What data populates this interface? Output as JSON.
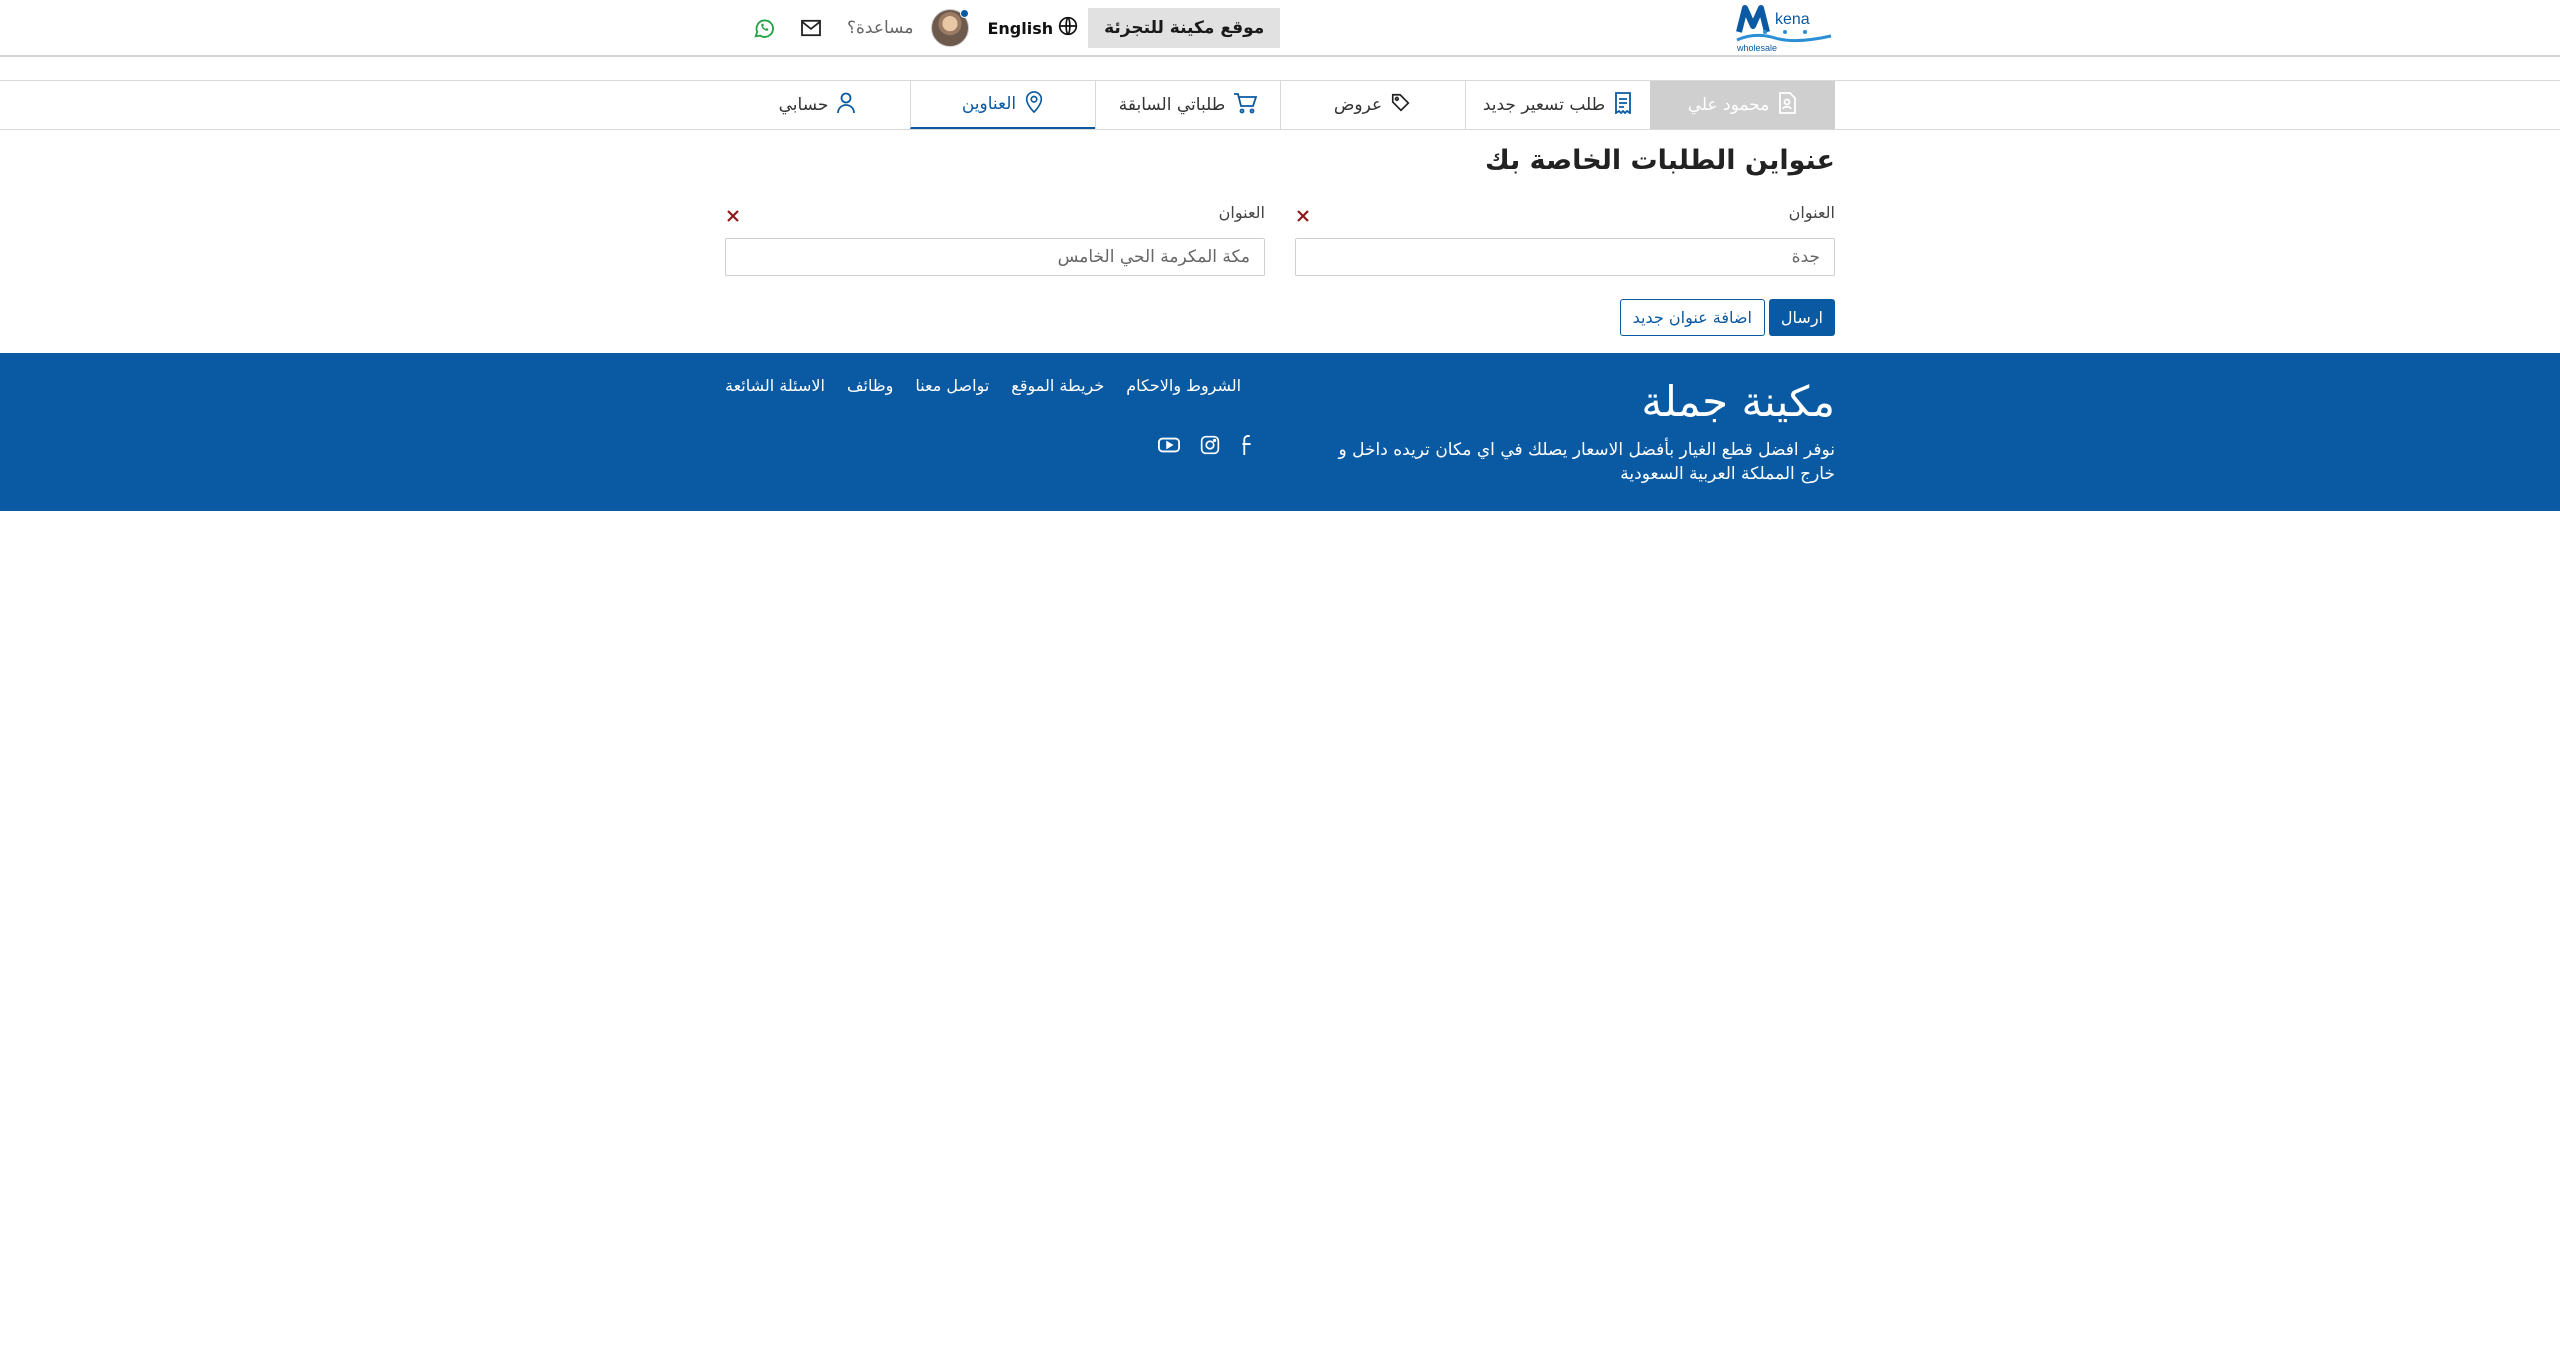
{
  "header": {
    "logo_text": "kena",
    "logo_sub": "wholesale",
    "retail_site": "موقع مكينة للتجزئة",
    "language": "English",
    "help": "مساعدة؟"
  },
  "tabs": [
    {
      "label": "محمود علي",
      "icon": "document-user-icon"
    },
    {
      "label": "طلب تسعير جديد",
      "icon": "receipt-icon"
    },
    {
      "label": "عروض",
      "icon": "tag-icon"
    },
    {
      "label": "طلباتي السابقة",
      "icon": "cart-icon"
    },
    {
      "label": "العناوين",
      "icon": "location-pin-icon"
    },
    {
      "label": "حسابي",
      "icon": "user-icon"
    }
  ],
  "main": {
    "title": "عنواين الطلبات الخاصة بك",
    "addresses": [
      {
        "label": "العنوان",
        "value": "جدة"
      },
      {
        "label": "العنوان",
        "value": "مكة المكرمة الحي الخامس"
      }
    ],
    "submit": "ارسال",
    "add_address": "اضافة عنوان جديد"
  },
  "footer": {
    "brand": "مكينة جملة",
    "description": "نوفر افضل قطع الغيار بأفضل الاسعار يصلك في اي مكان تريده داخل و خارج المملكة العربية السعودية",
    "links": [
      "الاسئلة الشائعة",
      "وظائف",
      "تواصل معنا",
      "خريطة الموقع",
      "الشروط والاحكام"
    ],
    "social": [
      "facebook-icon",
      "instagram-icon",
      "youtube-icon"
    ]
  },
  "colors": {
    "primary": "#0a5aa3",
    "delete": "#8b1a1a",
    "whatsapp": "#25a244"
  }
}
